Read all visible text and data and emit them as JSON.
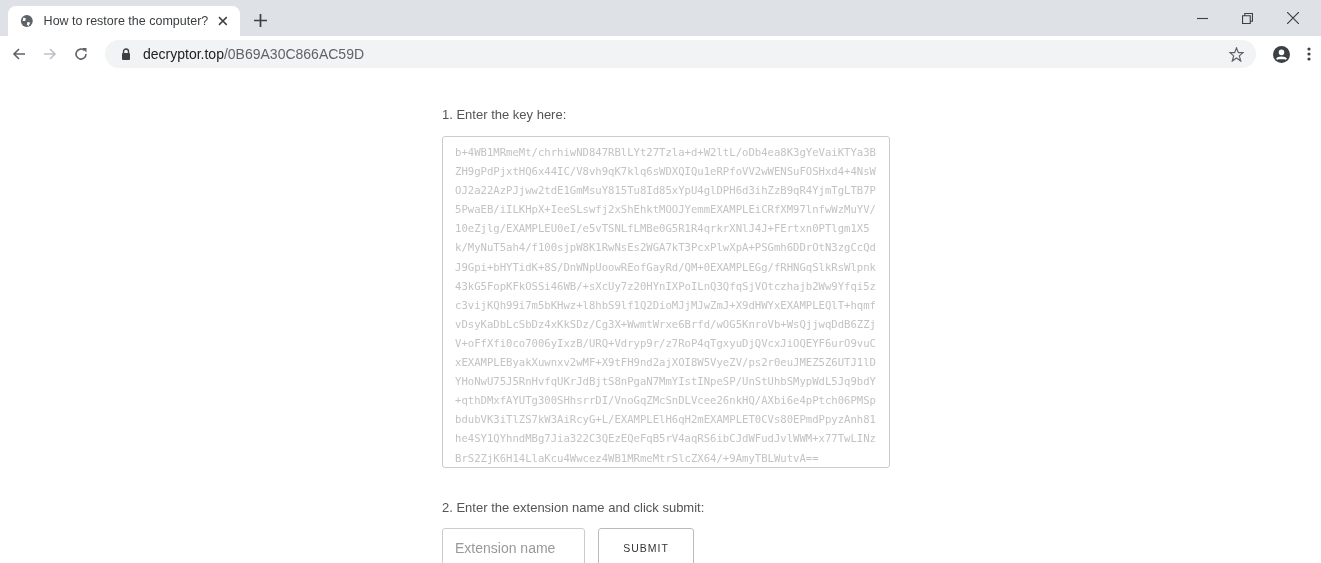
{
  "browser": {
    "tab": {
      "title": "How to restore the computer?",
      "selected": true
    },
    "url": {
      "domain": "decryptor.top",
      "path": "/0B69A30C866AC59D"
    }
  },
  "page": {
    "step_1": "1. Enter the key here:",
    "key": "b+4WB1MRmeMt/chrhiwND847RBlLYt27Tzla+d+W2ltL/oDb4ea8K3gYeVaiKTYa3BZH9gPdPjxtHQ6x44IC/V8vh9qK7klq6sWDXQIQu1eRPfoVV2wWENSuFOSHxd4+4NsWOJ2a22AzPJjww2tdE1GmMsuY815Tu8Id85xYpU4glDPH6d3ihZzB9qR4YjmTgLTB7P5PwaEB/iILKHpX+IeeSLswfj2xShEhktMOOJYemmEXAMPLEiCRfXM97lnfwWzMuYV/10eZjlg/EXAMPLEU0eI/e5vTSNLfLMBe0G5R1R4qrkrXNlJ4J+FErtxn0PTlgm1X5k/MyNuT5ah4/f100sjpW8K1RwNsEs2WGA7kT3PcxPlwXpA+PSGmh6DDrOtN3zgCcQdJ9Gpi+bHYTidK+8S/DnWNpUoowREofGayRd/QM+0EXAMPLEGg/fRHNGqSlkRsWlpnk43kG5FopKFkOSSi46WB/+sXcUy7z20HYnIXPoILnQ3QfqSjVOtczhajb2Ww9Yfqi5zc3vijKQh99i7m5bKHwz+l8hbS9lf1Q2DioMJjMJwZmJ+X9dHWYxEXAMPLEQlT+hqmfvDsyKaDbLcSbDz4xKkSDz/Cg3X+WwmtWrxe6Brfd/wOG5KnroVb+WsQjjwqDdB6ZZjV+oFfXfi0co7006yIxzB/URQ+Vdryp9r/z7RoP4qTgxyuDjQVcxJiOQEYF6urO9vuCxEXAMPLEByakXuwnxv2wMF+X9tFH9nd2ajXOI8W5VyeZV/ps2r0euJMEZ5Z6UTJ1lDYHoNwU75J5RnHvfqUKrJdBjtS8nPgaN7MmYIstINpeSP/UnStUhbSMypWdL5Jq9bdY+qthDMxfAYUTg300SHhsrrDI/VnoGqZMcSnDLVcee26nkHQ/AXbi6e4pPtch06PMSpbdubVK3iTlZS7kW3AiRcyG+L/EXAMPLElH6qH2mEXAMPLET0CVs80EPmdPpyzAnh81he4SY1QYhndMBg7Jia322C3QEzEQeFqB5rV4aqRS6ibCJdWFudJvlWWM+x77TwLINzBrS2ZjK6H14LlaKcu4Wwcez4WB1MRmeMtrSlcZX64/+9AmyTBLWutvA==",
    "step_2": "2. Enter the extension name and click submit:",
    "extension": {
      "placeholder": "Extension name"
    },
    "submit": "SUBMIT"
  }
}
